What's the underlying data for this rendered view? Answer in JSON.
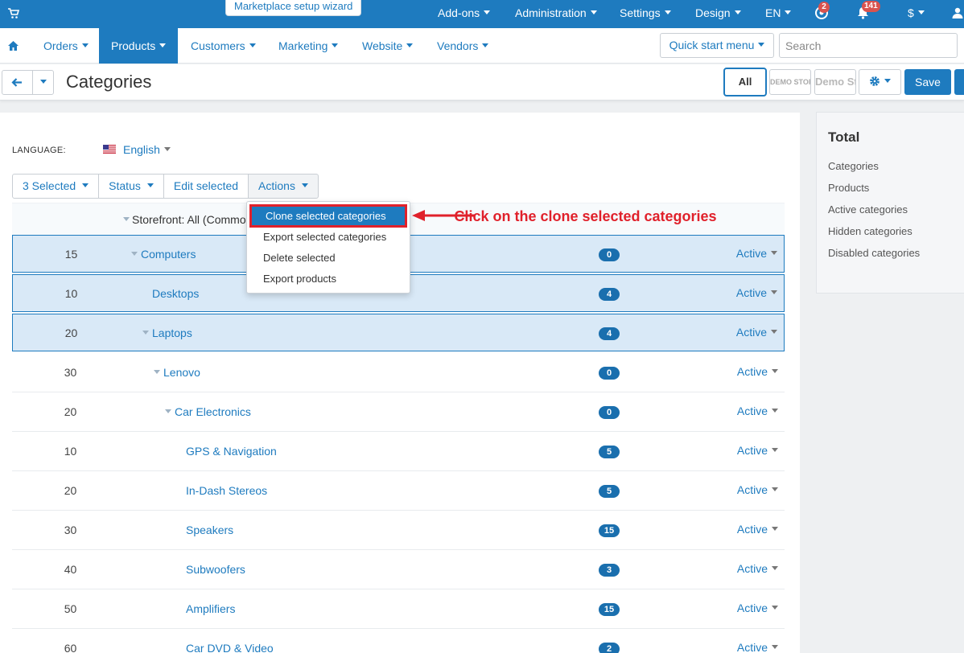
{
  "topbar": {
    "wizard_label": "Marketplace setup wizard",
    "menus": [
      "Add-ons",
      "Administration",
      "Settings",
      "Design",
      "EN"
    ],
    "help_badge": "2",
    "notif_badge": "141",
    "currency": "$"
  },
  "nav": {
    "items": [
      "Orders",
      "Products",
      "Customers",
      "Marketing",
      "Website",
      "Vendors"
    ],
    "active": "Products",
    "quick_start": "Quick start menu",
    "search_placeholder": "Search"
  },
  "header": {
    "title": "Categories",
    "storefront_all": "All",
    "storefront_1": "DEMO STORE",
    "storefront_2": "Demo Store",
    "save": "Save"
  },
  "language": {
    "label": "LANGUAGE:",
    "value": "English"
  },
  "toolbar": {
    "selected": "3 Selected",
    "status": "Status",
    "edit_selected": "Edit selected",
    "actions": "Actions"
  },
  "storefront_row": "Storefront: All (Common)",
  "actions_menu": [
    "Clone selected categories",
    "Export selected categories",
    "Delete selected",
    "Export products"
  ],
  "annotation": "Click on the clone selected categories",
  "categories": [
    {
      "pos": "15",
      "name": "Computers",
      "count": "0",
      "status": "Active",
      "selected": true
    },
    {
      "pos": "10",
      "name": "Desktops",
      "count": "4",
      "status": "Active",
      "selected": true
    },
    {
      "pos": "20",
      "name": "Laptops",
      "count": "4",
      "status": "Active",
      "selected": true
    },
    {
      "pos": "30",
      "name": "Lenovo",
      "count": "0",
      "status": "Active",
      "selected": false
    },
    {
      "pos": "20",
      "name": "Car Electronics",
      "count": "0",
      "status": "Active",
      "selected": false
    },
    {
      "pos": "10",
      "name": "GPS & Navigation",
      "count": "5",
      "status": "Active",
      "selected": false
    },
    {
      "pos": "20",
      "name": "In-Dash Stereos",
      "count": "5",
      "status": "Active",
      "selected": false
    },
    {
      "pos": "30",
      "name": "Speakers",
      "count": "15",
      "status": "Active",
      "selected": false
    },
    {
      "pos": "40",
      "name": "Subwoofers",
      "count": "3",
      "status": "Active",
      "selected": false
    },
    {
      "pos": "50",
      "name": "Amplifiers",
      "count": "15",
      "status": "Active",
      "selected": false
    },
    {
      "pos": "60",
      "name": "Car DVD & Video",
      "count": "2",
      "status": "Active",
      "selected": false
    }
  ],
  "totals": {
    "title": "Total",
    "items": [
      "Categories",
      "Products",
      "Active categories",
      "Hidden categories",
      "Disabled categories"
    ]
  },
  "colors": {
    "primary": "#1e7bbf",
    "annotation": "#e0212b",
    "selected_row": "#d9e9f7"
  }
}
